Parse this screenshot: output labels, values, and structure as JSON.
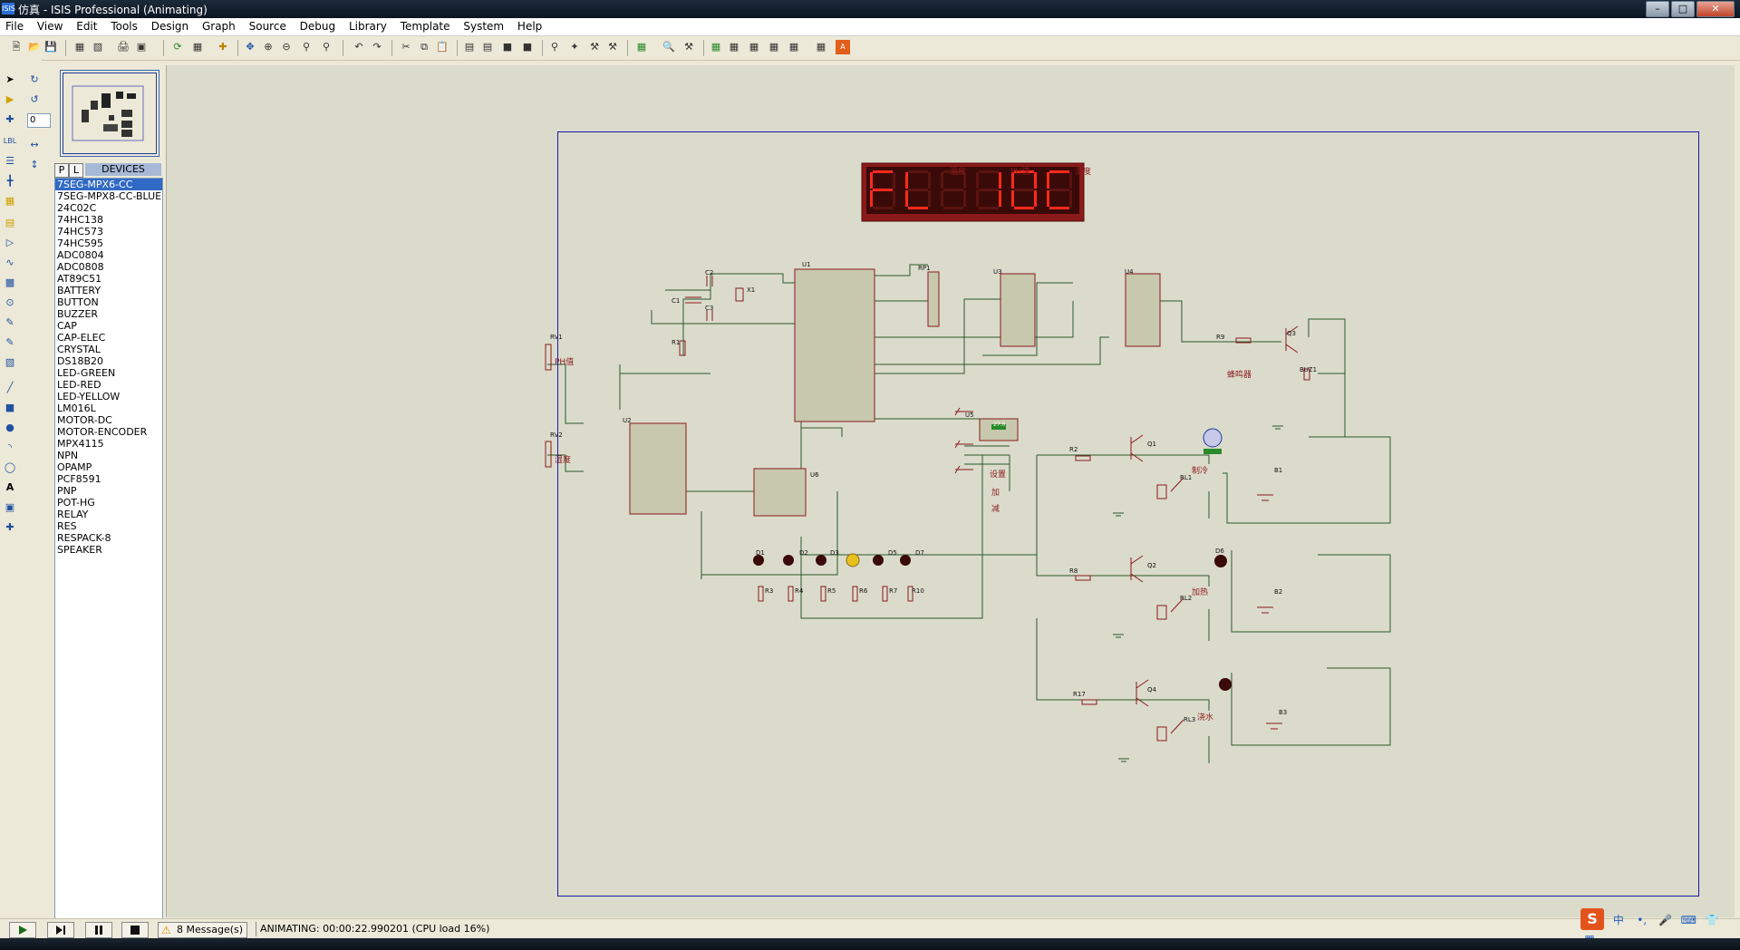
{
  "window": {
    "title": "仿真 - ISIS Professional (Animating)",
    "app_icon": "ISIS"
  },
  "menu": [
    "File",
    "View",
    "Edit",
    "Tools",
    "Design",
    "Graph",
    "Source",
    "Debug",
    "Library",
    "Template",
    "System",
    "Help"
  ],
  "rotation_value": "0",
  "devices": {
    "tab_p": "P",
    "tab_l": "L",
    "header": "DEVICES",
    "items": [
      "7SEG-MPX6-CC",
      "7SEG-MPX8-CC-BLUE",
      "24C02C",
      "74HC138",
      "74HC573",
      "74HC595",
      "ADC0804",
      "ADC0808",
      "AT89C51",
      "BATTERY",
      "BUTTON",
      "BUZZER",
      "CAP",
      "CAP-ELEC",
      "CRYSTAL",
      "DS18B20",
      "LED-GREEN",
      "LED-RED",
      "LED-YELLOW",
      "LM016L",
      "MOTOR-DC",
      "MOTOR-ENCODER",
      "MPX4115",
      "NPN",
      "OPAMP",
      "PCF8591",
      "PNP",
      "POT-HG",
      "RELAY",
      "RES",
      "RESPACK-8",
      "SPEAKER"
    ],
    "selected_index": 0
  },
  "schematic": {
    "display_headers": [
      "温度",
      "PH值",
      "湿度"
    ],
    "display_digits": [
      "F",
      "L",
      "",
      "1",
      "0",
      "C"
    ],
    "labels": {
      "u1": "U1",
      "u2": "U2",
      "u3": "U3",
      "u4": "U4",
      "u5": "U5",
      "u6": "U6",
      "rp1": "RP1",
      "rv1": "RV1",
      "rv2": "RV2",
      "c1": "C1",
      "c2": "C2",
      "c3": "C3",
      "x1": "X1",
      "r1": "R1",
      "r2": "R2",
      "r8": "R8",
      "r9": "R9",
      "r17": "R17",
      "q1": "Q1",
      "q2": "Q2",
      "q3": "Q3",
      "q4": "Q4",
      "rl1": "RL1",
      "rl2": "RL2",
      "rl3": "RL3",
      "buz1": "BUZ1",
      "b1": "B1",
      "b2": "B2",
      "b3": "B3",
      "d1": "D1",
      "d2": "D2",
      "d3": "D3",
      "d5": "D5",
      "d6": "D6",
      "d7": "D7",
      "r3": "R3",
      "r4": "R4",
      "r5": "R5",
      "r6": "R6",
      "r7": "R7",
      "r10": "R10",
      "ph": "PH值",
      "humidity": "湿度",
      "set": "设置",
      "add": "加",
      "sub": "减",
      "cool": "制冷",
      "heat": "加热",
      "water": "浇水",
      "buzzer": "蜂鸣器",
      "ds18b20_val": "27.0"
    }
  },
  "status": {
    "messages": "8 Message(s)",
    "animating": "ANIMATING: 00:00:22.990201 (CPU load 16%)"
  },
  "colors": {
    "canvas": "#dbdbcc",
    "sheet_border": "#1a1aa8",
    "wire": "#2a5a2a",
    "component": "#8b1a1a",
    "segment_on": "#ff2a1a",
    "segment_bg": "#3a0a08"
  }
}
